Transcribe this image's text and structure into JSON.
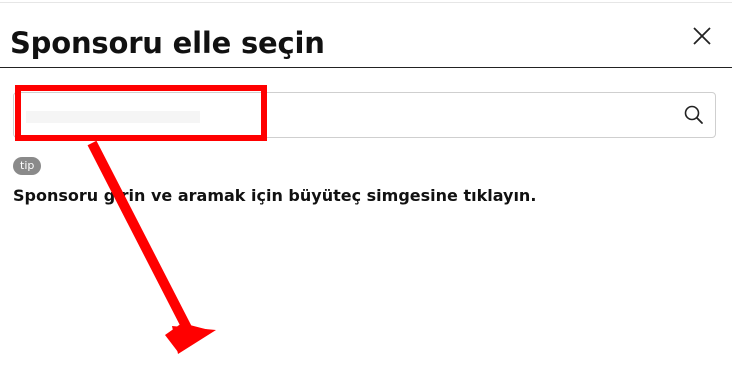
{
  "dialog": {
    "title": "Sponsoru elle seçin",
    "close_icon": "close-icon"
  },
  "search": {
    "value": "",
    "placeholder": "",
    "icon": "search-icon"
  },
  "tip": {
    "badge": "tip",
    "text": "Sponsoru girin ve aramak için büyüteç simgesine tıklayın."
  },
  "colors": {
    "annotation": "#ff0000",
    "badge": "#8a8a8a",
    "text": "#111111"
  }
}
